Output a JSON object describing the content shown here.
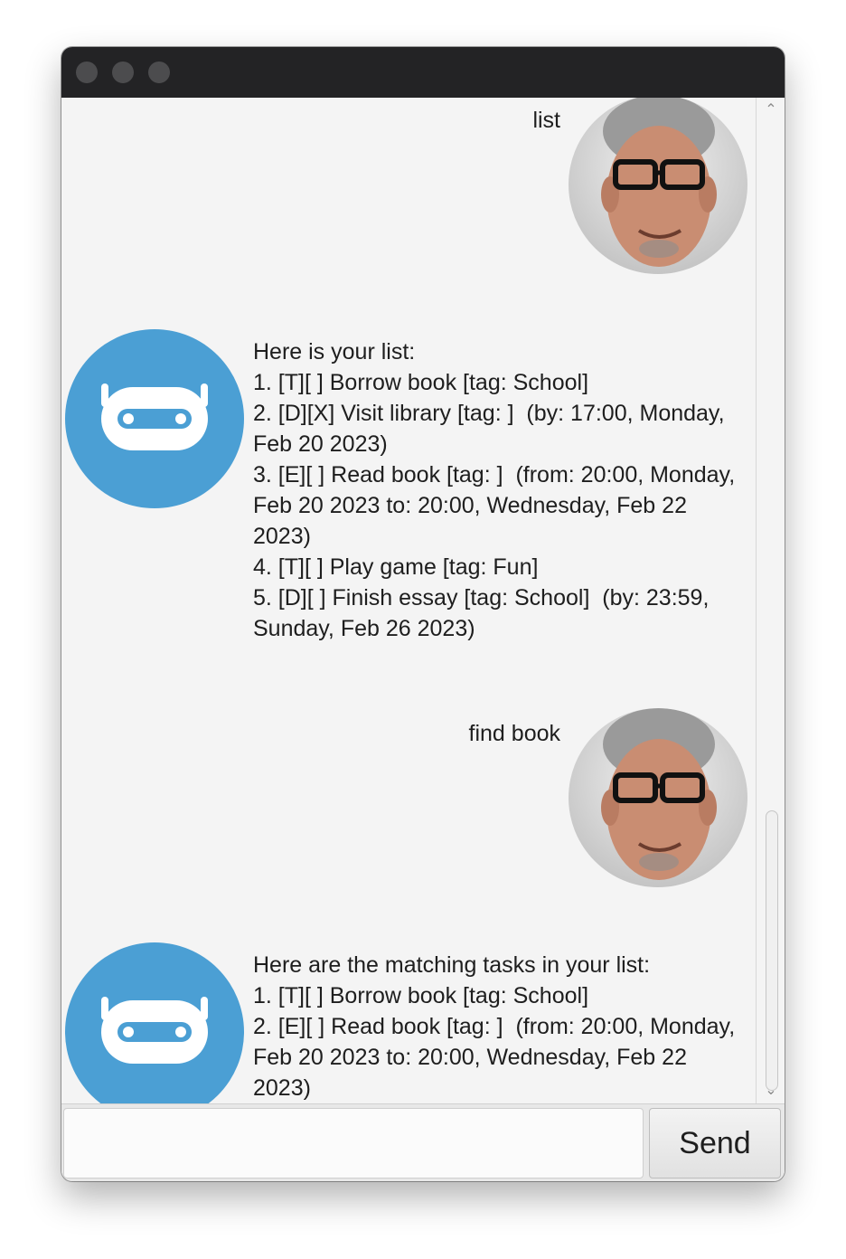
{
  "chat": {
    "messages": [
      {
        "sender": "user",
        "text": "list"
      },
      {
        "sender": "bot",
        "text": "Here is your list:\n1. [T][ ] Borrow book [tag: School]\n2. [D][X] Visit library [tag: ]  (by: 17:00, Monday,\nFeb 20 2023)\n3. [E][ ] Read book [tag: ]  (from: 20:00, Monday,\nFeb 20 2023 to: 20:00, Wednesday, Feb 22\n2023)\n4. [T][ ] Play game [tag: Fun]\n5. [D][ ] Finish essay [tag: School]  (by: 23:59,\nSunday, Feb 26 2023)"
      },
      {
        "sender": "user",
        "text": "find book"
      },
      {
        "sender": "bot",
        "text": "Here are the matching tasks in your list:\n1. [T][ ] Borrow book [tag: School]\n2. [E][ ] Read book [tag: ]  (from: 20:00, Monday,\nFeb 20 2023 to: 20:00, Wednesday, Feb 22\n2023)"
      }
    ]
  },
  "input": {
    "value": "",
    "placeholder": ""
  },
  "send_button": {
    "label": "Send"
  },
  "icons": {
    "user_avatar": "user-photo-avatar",
    "bot_avatar": "robot-face-icon"
  },
  "colors": {
    "bot_avatar_bg": "#4b9fd4",
    "titlebar": "#232325",
    "chat_bg": "#f4f4f4"
  }
}
